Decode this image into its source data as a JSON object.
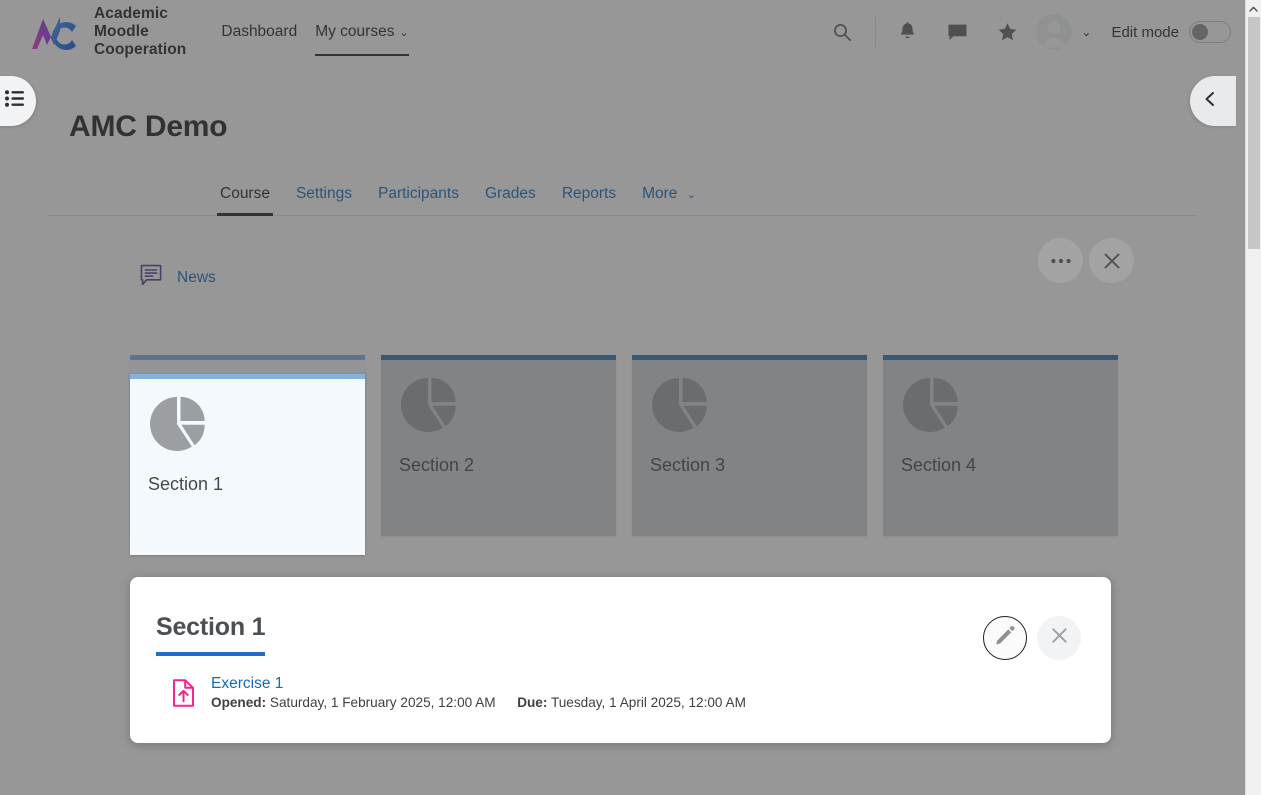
{
  "navbar": {
    "brand_name": "Academic\nMoodle\nCooperation",
    "logo_icon": "amc-logo",
    "links": [
      {
        "label": "Dashboard",
        "active": false,
        "caret": ""
      },
      {
        "label": "My courses",
        "active": true,
        "caret": "⌄"
      }
    ],
    "icons": [
      {
        "name": "search-icon"
      },
      {
        "name": "notifications-bell-icon"
      },
      {
        "name": "messages-icon"
      },
      {
        "name": "star-icon"
      }
    ],
    "avatar_icon": "user-avatar",
    "avatar_caret": "⌄",
    "edit_mode": {
      "label": "Edit mode",
      "enabled": false
    }
  },
  "course": {
    "title": "AMC Demo",
    "tabs": [
      {
        "label": "Course",
        "active": true,
        "caret": ""
      },
      {
        "label": "Settings",
        "active": false,
        "caret": ""
      },
      {
        "label": "Participants",
        "active": false,
        "caret": ""
      },
      {
        "label": "Grades",
        "active": false,
        "caret": ""
      },
      {
        "label": "Reports",
        "active": false,
        "caret": ""
      },
      {
        "label": "More",
        "active": false,
        "caret": "⌄"
      }
    ]
  },
  "news": {
    "label": "News",
    "icon": "forum-icon"
  },
  "sections": [
    {
      "label": "Section 1",
      "active": true,
      "icon": "pie-chart-icon"
    },
    {
      "label": "Section 2",
      "active": false,
      "icon": "pie-chart-icon"
    },
    {
      "label": "Section 3",
      "active": false,
      "icon": "pie-chart-icon"
    },
    {
      "label": "Section 4",
      "active": false,
      "icon": "pie-chart-icon"
    }
  ],
  "overlay_buttons": [
    {
      "name": "more-options-button",
      "glyph": "•••"
    },
    {
      "name": "close-button",
      "glyph": "✕"
    }
  ],
  "drawers": {
    "left_toggle_icon": "list-menu-icon",
    "right_toggle_icon": "chevron-left-icon"
  },
  "modal": {
    "title": "Section 1",
    "edit_button": {
      "name": "edit-pencil-button",
      "icon": "pencil-icon",
      "focused": true
    },
    "close_button": {
      "name": "close-button",
      "icon": "close-icon"
    },
    "activity": {
      "icon": "assignment-icon",
      "name": "Exercise 1",
      "opened_label": "Opened:",
      "opened_value": "Saturday, 1 February 2025, 12:00 AM",
      "due_label": "Due:",
      "due_value": "Tuesday, 1 April 2025, 12:00 AM"
    }
  },
  "colors": {
    "link": "#0f6cbf",
    "accent_blue": "#2f74b5",
    "active_card_bg": "#f4f9fd",
    "card_bg": "#cfd2d4",
    "assignment_pink": "#f2268c",
    "forum_purple": "#5b3b9c",
    "text_dark": "#1d2125"
  },
  "scrollbar": {
    "up_arrow": "▲"
  }
}
